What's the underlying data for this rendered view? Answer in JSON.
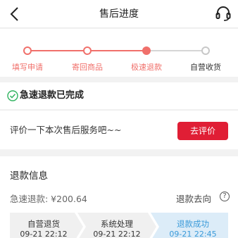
{
  "nav": {
    "title": "售后进度"
  },
  "steps": [
    {
      "label": "填写申请",
      "state": "done"
    },
    {
      "label": "寄回商品",
      "state": "done"
    },
    {
      "label": "极速退款",
      "state": "current"
    },
    {
      "label": "自营收货",
      "state": "todo"
    }
  ],
  "status": {
    "text": "急速退款已完成"
  },
  "review": {
    "prompt": "评价一下本次售后服务吧~~",
    "button": "去评价"
  },
  "refund": {
    "title": "退款信息",
    "amount_label": "急速退款: ¥200.64",
    "destination": "退款去向",
    "flow": [
      {
        "title": "自营退货",
        "time": "09-21 22:12",
        "active": false
      },
      {
        "title": "系统处理",
        "time": "09-21 22:12",
        "active": false
      },
      {
        "title": "退款成功",
        "time": "09-21 22:45",
        "active": true
      }
    ]
  },
  "colors": {
    "accent": "#f0706b",
    "button": "#e01e35",
    "success": "#3a9ad9",
    "check": "#2fb35f"
  }
}
